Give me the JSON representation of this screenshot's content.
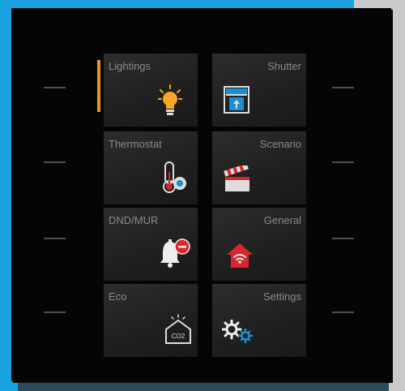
{
  "keypad": {
    "tiles": [
      {
        "label": "Lightings",
        "icon": "lightbulb-icon"
      },
      {
        "label": "Shutter",
        "icon": "shutter-icon"
      },
      {
        "label": "Thermostat",
        "icon": "thermometer-icon"
      },
      {
        "label": "Scenario",
        "icon": "clapperboard-icon"
      },
      {
        "label": "DND/MUR",
        "icon": "bell-icon"
      },
      {
        "label": "General",
        "icon": "home-wifi-icon"
      },
      {
        "label": "Eco",
        "icon": "co2-house-icon"
      },
      {
        "label": "Settings",
        "icon": "gears-icon"
      }
    ],
    "indicators": {
      "lightings": {
        "color": "#e8951c",
        "active": true
      },
      "general": {
        "color": "#d92b2b",
        "active": true
      }
    },
    "co2_text": "CO2",
    "accent_colors": {
      "bulb": "#f5a623",
      "house": "#d9262c",
      "dnd_badge": "#e02828",
      "gear": "#1b8fd0"
    }
  }
}
